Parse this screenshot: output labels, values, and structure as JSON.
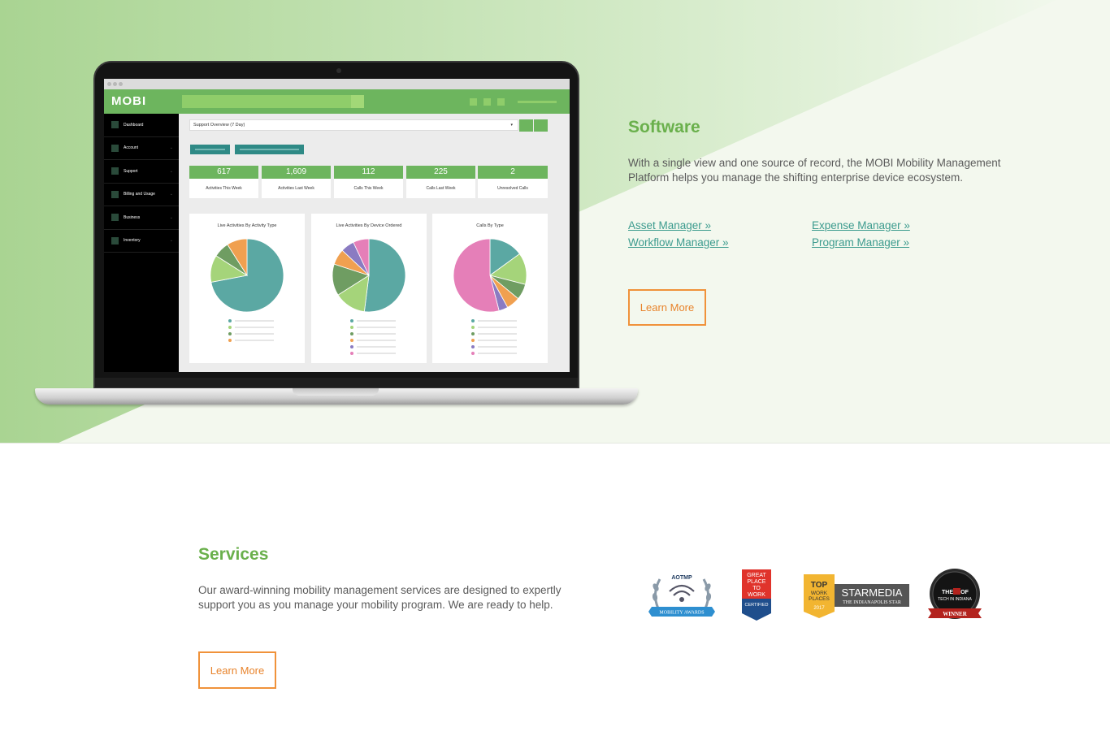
{
  "colors": {
    "accent_green": "#6ab04c",
    "link_teal": "#3c9b8e",
    "button_orange": "#f0923a",
    "body_text": "#5b5b5b"
  },
  "laptop_app": {
    "logo": "MOBI",
    "select_label": "Support Overview (7 Day)",
    "sidebar": [
      "Dashboard",
      "Account",
      "Support",
      "Billing and Usage",
      "Business",
      "Inventory"
    ],
    "stats": [
      {
        "value": "617",
        "label": "Activities This Week"
      },
      {
        "value": "1,609",
        "label": "Activities Last Week"
      },
      {
        "value": "112",
        "label": "Calls This Week"
      },
      {
        "value": "225",
        "label": "Calls Last Week"
      },
      {
        "value": "2",
        "label": "Unresolved Calls"
      }
    ],
    "charts": [
      {
        "title": "Live Activities By Activity Type",
        "slices": [
          {
            "value": 72,
            "color": "#5ba8a3"
          },
          {
            "value": 12,
            "color": "#a5d47a"
          },
          {
            "value": 7,
            "color": "#6f9d62"
          },
          {
            "value": 9,
            "color": "#f0a050"
          }
        ],
        "legend_colors": [
          "#5ba8a3",
          "#a5d47a",
          "#6f9d62",
          "#f0a050"
        ]
      },
      {
        "title": "Live Activities By Device Ordered",
        "slices": [
          {
            "value": 52,
            "color": "#5ba8a3"
          },
          {
            "value": 14,
            "color": "#a5d47a"
          },
          {
            "value": 14,
            "color": "#6f9d62"
          },
          {
            "value": 7,
            "color": "#f0a050"
          },
          {
            "value": 6,
            "color": "#8a7bc2"
          },
          {
            "value": 7,
            "color": "#e57fb8"
          }
        ],
        "legend_colors": [
          "#5ba8a3",
          "#a5d47a",
          "#6f9d62",
          "#f0a050",
          "#8a7bc2",
          "#e57fb8"
        ]
      },
      {
        "title": "Calls By Type",
        "slices": [
          {
            "value": 15,
            "color": "#5ba8a3"
          },
          {
            "value": 14,
            "color": "#a5d47a"
          },
          {
            "value": 7,
            "color": "#6f9d62"
          },
          {
            "value": 6,
            "color": "#f0a050"
          },
          {
            "value": 4,
            "color": "#8a7bc2"
          },
          {
            "value": 54,
            "color": "#e57fb8"
          }
        ],
        "legend_colors": [
          "#5ba8a3",
          "#a5d47a",
          "#6f9d62",
          "#f0a050",
          "#8a7bc2",
          "#e57fb8"
        ]
      }
    ]
  },
  "software": {
    "title": "Software",
    "description": "With a single view and one source of record, the MOBI Mobility Management Platform helps you manage the shifting enterprise device ecosystem.",
    "links": [
      "Asset Manager »",
      "Workflow Manager »",
      "Expense Manager »",
      "Program Manager »"
    ],
    "button": "Learn More"
  },
  "services": {
    "title": "Services",
    "description": "Our award-winning mobility management services are designed to expertly support you as you manage your mobility program. We are ready to help.",
    "button": "Learn More"
  },
  "awards": {
    "aotmp": {
      "top": "AOTMP",
      "ribbon": "MOBILITY AWARDS"
    },
    "great_place": {
      "lines": [
        "GREAT",
        "PLACE",
        "TO",
        "WORK"
      ],
      "certified": "CERTIFIED"
    },
    "top_workplaces": {
      "badge": [
        "TOP",
        "WORK",
        "PLACES"
      ],
      "year": "2017",
      "brand": "STARMEDIA",
      "sub": "THE INDIANAPOLIS STAR"
    },
    "tech_award": {
      "line1": "THE",
      "line2": "OF",
      "line3": "TECH IN INDIANA",
      "ribbon": "WINNER"
    }
  }
}
